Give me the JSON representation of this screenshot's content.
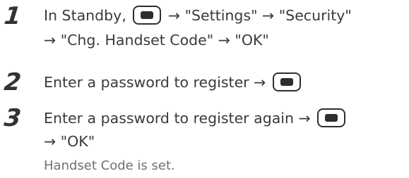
{
  "steps": [
    {
      "number": "1",
      "line1": {
        "a": "In Standby,",
        "key": "center-key-icon",
        "b": "→ \"Settings\" → \"Security\""
      },
      "line2": "→ \"Chg. Handset Code\" → \"OK\""
    },
    {
      "number": "2",
      "line1": {
        "a": "Enter a password to register →",
        "key": "center-key-icon"
      }
    },
    {
      "number": "3",
      "line1": {
        "a": "Enter a password to register again →",
        "key": "center-key-icon"
      },
      "line2": "→ \"OK\""
    }
  ],
  "result": "Handset Code is set."
}
